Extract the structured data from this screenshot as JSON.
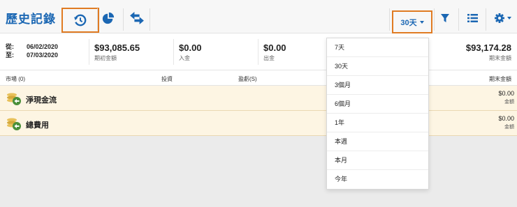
{
  "header": {
    "title": "歷史記錄",
    "range_label": "30天"
  },
  "icons": {
    "history": "history-icon",
    "pie": "pie-chart-icon",
    "transfer": "transfer-arrows-icon",
    "filter": "filter-icon",
    "list": "list-icon",
    "settings": "gear-icon"
  },
  "colors": {
    "accent": "#1b67b3",
    "highlight": "#e07b22",
    "row_bg": "#fdf5e3"
  },
  "summary": {
    "from_label": "從:",
    "from_date": "06/02/2020",
    "to_label": "至:",
    "to_date": "07/03/2020",
    "opening_amount": "$93,085.65",
    "opening_label": "期初金額",
    "deposit_amount": "$0.00",
    "deposit_label": "入金",
    "withdraw_amount": "$0.00",
    "withdraw_label": "出金",
    "closing_amount": "$93,174.28",
    "closing_label": "期末金額"
  },
  "columns": {
    "market": "市場 (0)",
    "investment": "投資",
    "pnl": "盈虧(S)",
    "closing": "期末金額"
  },
  "rows": [
    {
      "name": "淨現金流",
      "amount": "$0.00",
      "amount_label": "金額"
    },
    {
      "name": "總費用",
      "amount": "$0.00",
      "amount_label": "金額"
    }
  ],
  "dropdown": {
    "options": [
      "7天",
      "30天",
      "3個月",
      "6個月",
      "1年",
      "本週",
      "本月",
      "今年"
    ]
  }
}
